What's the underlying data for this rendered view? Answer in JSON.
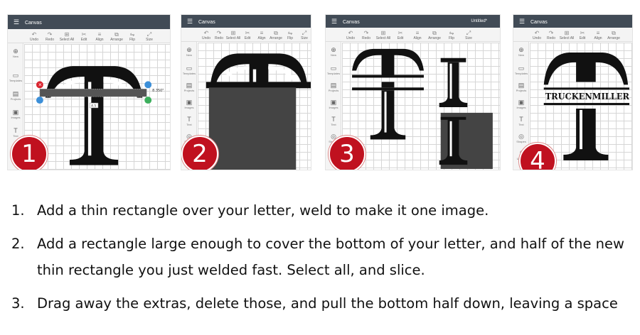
{
  "panels": [
    {
      "badge": "1",
      "app_title": "Canvas",
      "toolbar": [
        "Undo",
        "Redo",
        "Select All",
        "Edit",
        "Align",
        "Arrange",
        "Flip",
        "Size"
      ],
      "leftbar": [
        "New",
        "Templates",
        "Projects",
        "Images",
        "Text",
        "Shapes"
      ],
      "dimension_label": "8.350\"",
      "handle_label": "4.5"
    },
    {
      "badge": "2",
      "app_title": "Canvas",
      "toolbar": [
        "Undo",
        "Redo",
        "Select All",
        "Edit",
        "Align",
        "Arrange",
        "Flip",
        "Size"
      ],
      "leftbar": [
        "New",
        "Templates",
        "Projects",
        "Images",
        "Text",
        "Shapes",
        "Upload"
      ]
    },
    {
      "badge": "3",
      "app_title": "Canvas",
      "project_name": "Untitled*",
      "toolbar": [
        "Undo",
        "Redo",
        "Select All",
        "Edit",
        "Align",
        "Arrange",
        "Flip",
        "Size"
      ],
      "leftbar": [
        "New",
        "Templates",
        "Projects",
        "Images",
        "Text",
        "Shapes",
        "Upload"
      ]
    },
    {
      "badge": "4",
      "app_title": "Canvas",
      "toolbar": [
        "Undo",
        "Redo",
        "Select All",
        "Edit",
        "Align",
        "Arrange"
      ],
      "leftbar": [
        "New",
        "Templates",
        "Projects",
        "Images",
        "Text",
        "Shapes",
        "Upload"
      ],
      "name_text": "TRUCKENMILLER"
    }
  ],
  "steps": [
    {
      "num": "1.",
      "text": "Add a thin rectangle over your letter, weld to make it one image."
    },
    {
      "num": "2.",
      "text": "Add a rectangle large enough to cover the bottom of your letter, and half of the new thin rectangle you just welded fast. Select all, and slice."
    },
    {
      "num": "3.",
      "text": "Drag away the extras, delete those, and pull the bottom half down, leaving a space"
    }
  ],
  "colors": {
    "badge": "#c0111f",
    "topbar": "#414b56",
    "letter": "#111111",
    "slice_rect": "#444444"
  }
}
